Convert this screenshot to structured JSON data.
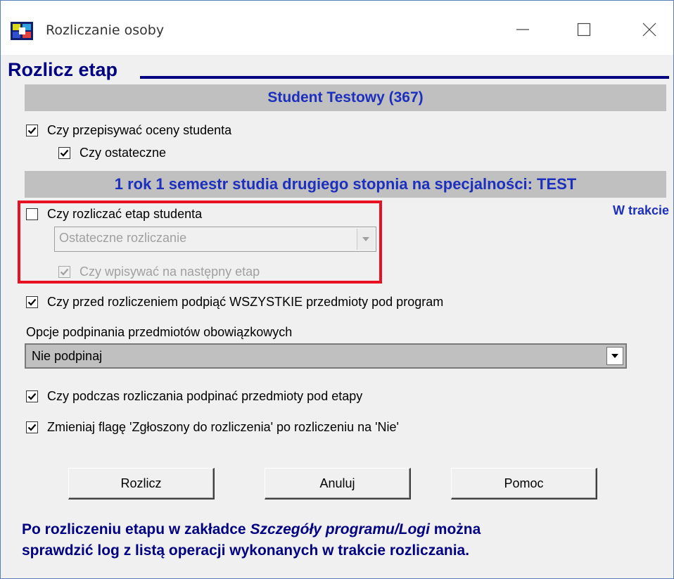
{
  "window": {
    "title": "Rozliczanie osoby"
  },
  "heading": "Rozlicz etap",
  "student_band": "Student Testowy (367)",
  "options": {
    "copy_grades": {
      "label": "Czy przepisywać oceny studenta",
      "checked": true
    },
    "final": {
      "label": "Czy ostateczne",
      "checked": true
    }
  },
  "stage_band": "1 rok 1 semestr studia drugiego stopnia na specjalności: TEST",
  "stage": {
    "settle": {
      "label": "Czy rozliczać etap studenta",
      "checked": false
    },
    "status": "W trakcie",
    "mode_select": {
      "value": "Ostateczne rozliczanie",
      "disabled": true
    },
    "enroll_next": {
      "label": "Czy wpisywać na następny etap",
      "checked": true,
      "disabled": true
    }
  },
  "attach_all": {
    "label": "Czy przed rozliczeniem podpiąć WSZYSTKIE przedmioty pod program",
    "checked": true
  },
  "mandatory_options": {
    "label": "Opcje podpinania przedmiotów obowiązkowych",
    "value": "Nie podpinaj"
  },
  "attach_stages": {
    "label": "Czy podczas rozliczania podpinać przedmioty pod etapy",
    "checked": true
  },
  "change_flag": {
    "label": "Zmieniaj flagę 'Zgłoszony do rozliczenia' po rozliczeniu na 'Nie'",
    "checked": true
  },
  "buttons": {
    "settle": "Rozlicz",
    "cancel": "Anuluj",
    "help": "Pomoc"
  },
  "info": {
    "part1": "Po rozliczeniu etapu w zakładce ",
    "italic": "Szczegóły programu/Logi",
    "part2": " można",
    "line2": "sprawdzić log z listą operacji wykonanych w trakcie rozliczania."
  },
  "colors": {
    "accent": "#000080",
    "band_text": "#1c2fbd",
    "highlight": "#e81123",
    "band_bg": "#c0c0c0"
  }
}
